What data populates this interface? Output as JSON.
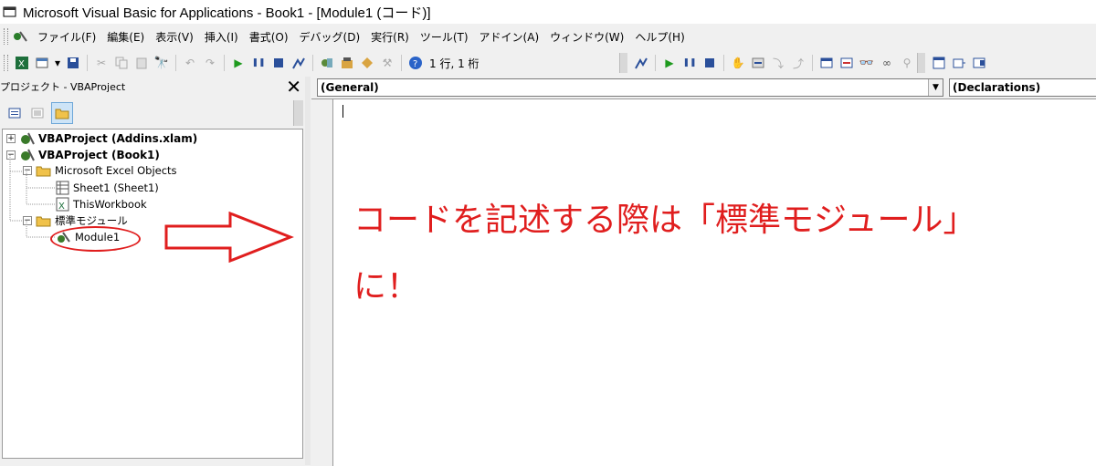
{
  "window": {
    "title": "Microsoft Visual Basic for Applications - Book1 - [Module1 (コード)]"
  },
  "menu": [
    "ファイル(F)",
    "編集(E)",
    "表示(V)",
    "挿入(I)",
    "書式(O)",
    "デバッグ(D)",
    "実行(R)",
    "ツール(T)",
    "アドイン(A)",
    "ウィンドウ(W)",
    "ヘルプ(H)"
  ],
  "toolbar": {
    "position": "1 行, 1 桁"
  },
  "project": {
    "title": "プロジェクト - VBAProject",
    "close": "✕",
    "nodes": [
      "VBAProject (Addins.xlam)",
      "VBAProject (Book1)",
      "Microsoft Excel Objects",
      "Sheet1 (Sheet1)",
      "ThisWorkbook",
      "標準モジュール",
      "Module1"
    ]
  },
  "code": {
    "object_combo": "(General)",
    "proc_combo": "(Declarations)"
  },
  "annotation": {
    "line1": "コードを記述する際は「標準モジュール」",
    "line2": "に！",
    "color": "#e01e1e"
  }
}
